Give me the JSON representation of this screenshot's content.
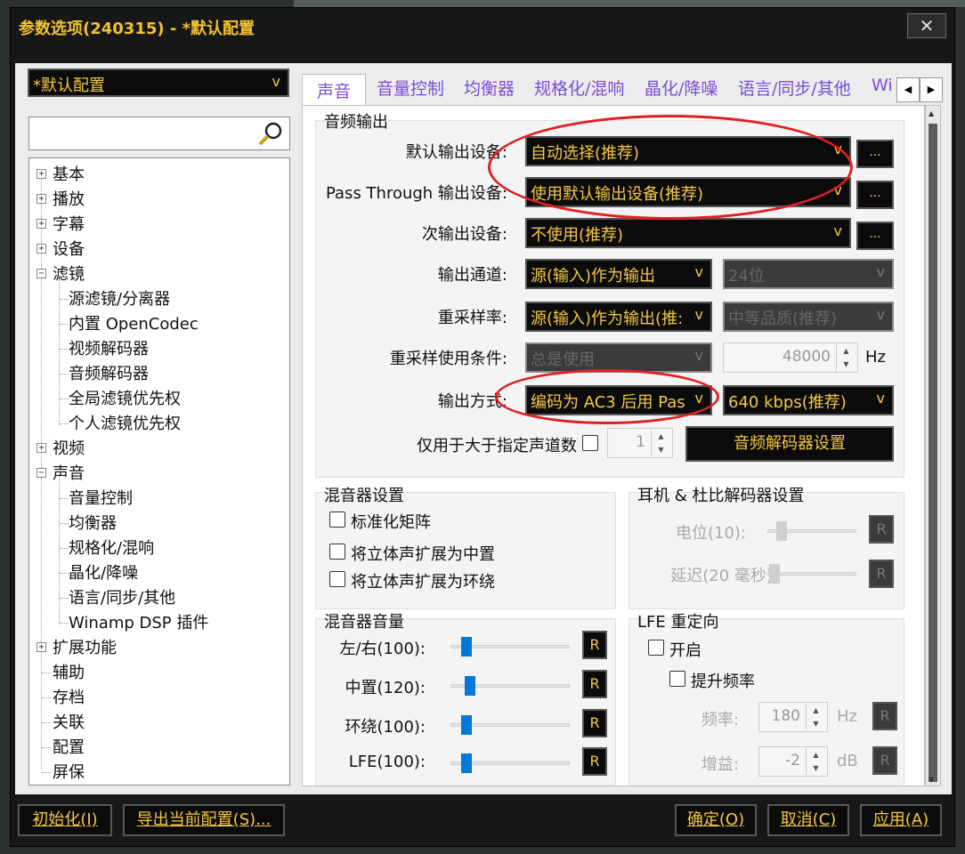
{
  "window": {
    "title": "参数选项(240315) - *默认配置",
    "close_label": "✕"
  },
  "profile": {
    "selected": "*默认配置"
  },
  "tree": {
    "items": [
      {
        "label": "基本",
        "expanded": false
      },
      {
        "label": "播放",
        "expanded": false
      },
      {
        "label": "字幕",
        "expanded": false
      },
      {
        "label": "设备",
        "expanded": false
      },
      {
        "label": "滤镜",
        "expanded": true
      },
      {
        "label": "源滤镜/分离器"
      },
      {
        "label": "内置 OpenCodec"
      },
      {
        "label": "视频解码器"
      },
      {
        "label": "音频解码器"
      },
      {
        "label": "全局滤镜优先权"
      },
      {
        "label": "个人滤镜优先权"
      },
      {
        "label": "视频",
        "expanded": false
      },
      {
        "label": "声音",
        "expanded": true
      },
      {
        "label": "音量控制"
      },
      {
        "label": "均衡器"
      },
      {
        "label": "规格化/混响"
      },
      {
        "label": "晶化/降噪"
      },
      {
        "label": "语言/同步/其他"
      },
      {
        "label": "Winamp DSP 插件"
      },
      {
        "label": "扩展功能",
        "expanded": false
      },
      {
        "label": "辅助"
      },
      {
        "label": "存档"
      },
      {
        "label": "关联"
      },
      {
        "label": "配置"
      },
      {
        "label": "屏保"
      }
    ]
  },
  "tabs": [
    {
      "label": "声音",
      "selected": true
    },
    {
      "label": "音量控制"
    },
    {
      "label": "均衡器"
    },
    {
      "label": "规格化/混响"
    },
    {
      "label": "晶化/降噪"
    },
    {
      "label": "语言/同步/其他"
    },
    {
      "label": "Wi"
    }
  ],
  "audio_output": {
    "group_title": "音频输出",
    "default_device": {
      "label": "默认输出设备:",
      "value": "自动选择(推荐)"
    },
    "passthrough_device": {
      "label": "Pass Through 输出设备:",
      "value": "使用默认输出设备(推荐)"
    },
    "secondary_device": {
      "label": "次输出设备:",
      "value": "不使用(推荐)"
    },
    "channels": {
      "label": "输出通道:",
      "value": "源(输入)作为输出",
      "bits": "24位"
    },
    "resample_rate": {
      "label": "重采样率:",
      "value": "源(输入)作为输出(推:",
      "quality": "中等品质(推荐)"
    },
    "resample_condition": {
      "label": "重采样使用条件:",
      "value": "总是使用",
      "freq": "48000",
      "unit": "Hz"
    },
    "output_mode": {
      "label": "输出方式:",
      "value": "编码为 AC3 后用 Pas",
      "bitrate": "640 kbps(推荐)"
    },
    "channel_limit": {
      "label": "仅用于大于指定声道数",
      "value": "1"
    },
    "decoder_settings_button": "音频解码器设置",
    "ellipsis": "..."
  },
  "mixer_settings": {
    "title": "混音器设置",
    "normalize_matrix": "标准化矩阵",
    "expand_center": "将立体声扩展为中置",
    "expand_surround": "将立体声扩展为环绕"
  },
  "headphone": {
    "title": "耳机 & 杜比解码器设置",
    "level_label": "电位(10):",
    "delay_label": "延迟(20 毫秒):",
    "reset": "R"
  },
  "mixer_volume": {
    "title": "混音器音量",
    "sliders": [
      {
        "label": "左/右(100):",
        "value": 100
      },
      {
        "label": "中置(120):",
        "value": 120
      },
      {
        "label": "环绕(100):",
        "value": 100
      },
      {
        "label": "LFE(100):",
        "value": 100
      }
    ],
    "reset": "R"
  },
  "lfe": {
    "title": "LFE 重定向",
    "enable": "开启",
    "boost": "提升频率",
    "freq_label": "频率:",
    "freq_value": "180",
    "freq_unit": "Hz",
    "gain_label": "增益:",
    "gain_value": "-2",
    "gain_unit": "dB",
    "reset": "R"
  },
  "buttons": {
    "init": "初始化(I)",
    "export": "导出当前配置(S)...",
    "ok": "确定(O)",
    "cancel": "取消(C)",
    "apply": "应用(A)"
  },
  "colors": {
    "accent_text": "#f4c842",
    "tab_text": "#7a4fd6",
    "annotation": "#e02020",
    "slider": "#0078d7"
  }
}
